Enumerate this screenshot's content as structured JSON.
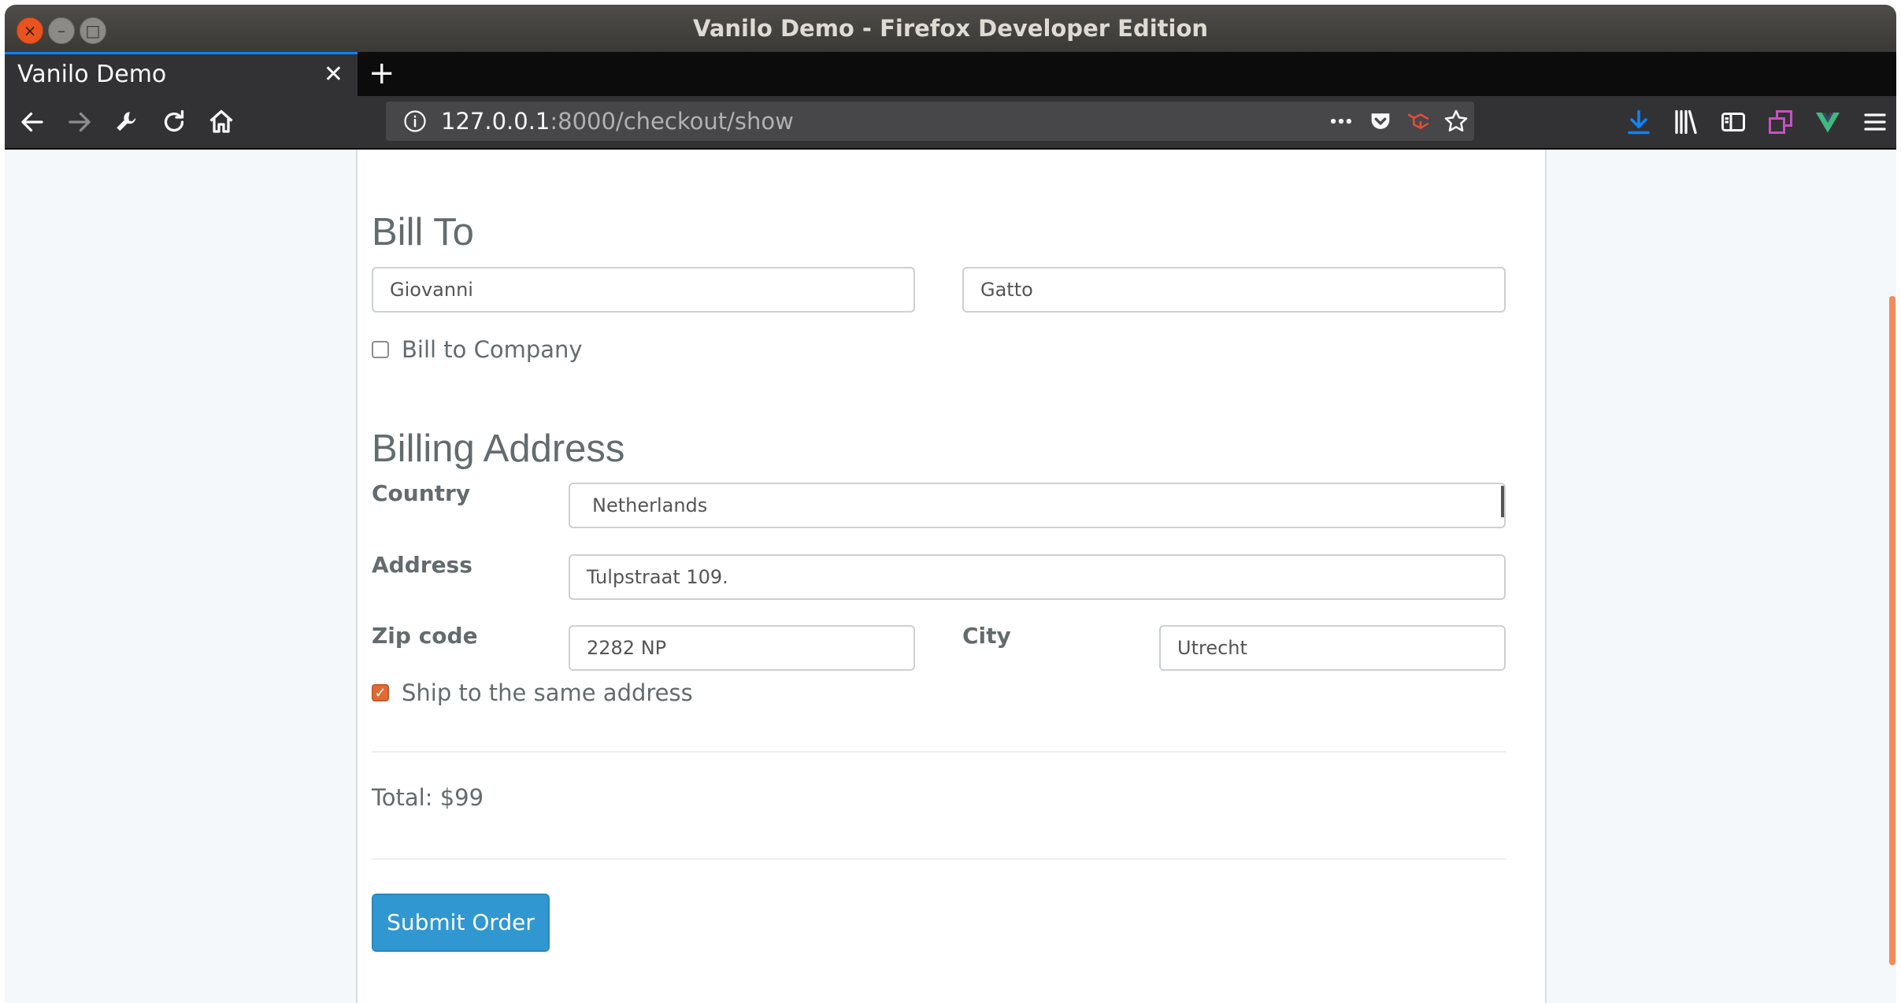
{
  "window": {
    "title": "Vanilo Demo - Firefox Developer Edition"
  },
  "tab": {
    "title": "Vanilo Demo",
    "close_glyph": "✕",
    "new_tab_glyph": "+"
  },
  "url": {
    "host": "127.0.0.1",
    "rest": ":8000/checkout/show"
  },
  "bill_to": {
    "heading": "Bill To",
    "first_name": "Giovanni",
    "last_name": "Gatto",
    "company_checkbox_label": "Bill to Company",
    "company_checked": false
  },
  "billing_address": {
    "heading": "Billing Address",
    "country_label": "Country",
    "country_value": "Netherlands",
    "address_label": "Address",
    "address_value": "Tulpstraat 109.",
    "zip_label": "Zip code",
    "zip_value": "2282 NP",
    "city_label": "City",
    "city_value": "Utrecht",
    "ship_same_label": "Ship to the same address",
    "ship_same_checked": true
  },
  "order": {
    "total": "Total: $99",
    "submit_label": "Submit Order"
  },
  "colors": {
    "accent": "#3097d1",
    "checkbox": "#e06b36",
    "scrollbar": "#f28c5a",
    "vue_green": "#41b883"
  }
}
